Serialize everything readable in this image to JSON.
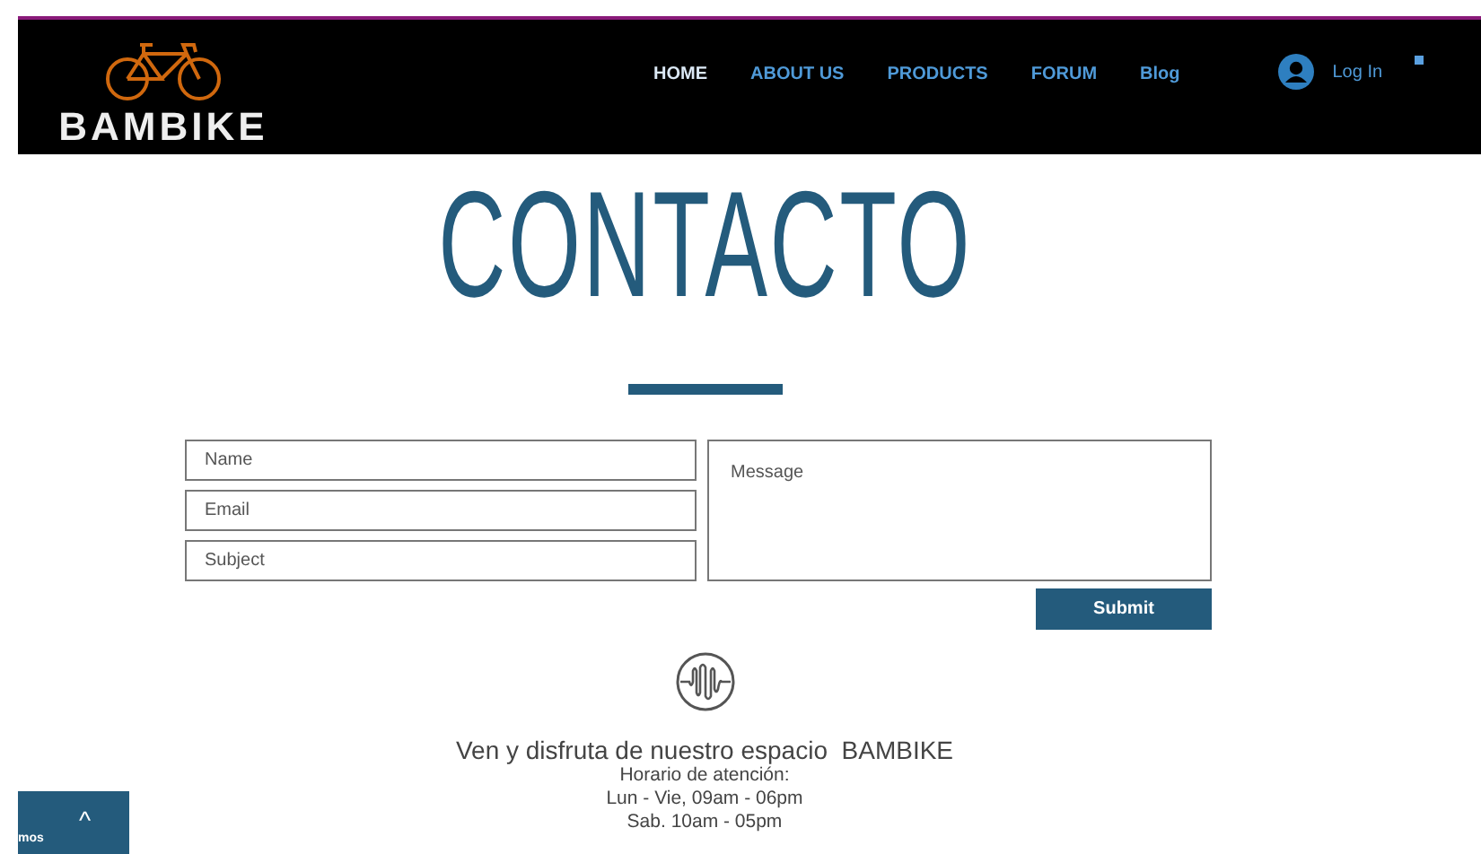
{
  "header": {
    "logo_text": "BAMBIKE",
    "nav": [
      {
        "label": "HOME",
        "selected": true
      },
      {
        "label": "ABOUT US",
        "selected": false
      },
      {
        "label": "PRODUCTS",
        "selected": false
      },
      {
        "label": "FORUM",
        "selected": false
      },
      {
        "label": "Blog",
        "selected": false
      }
    ],
    "login": "Log In"
  },
  "title": "CONTACTO",
  "form": {
    "fields": [
      {
        "placeholder": "Name"
      },
      {
        "placeholder": "Email"
      },
      {
        "placeholder": "Subject"
      }
    ],
    "message": {
      "placeholder": "Message"
    },
    "submit": "Submit"
  },
  "info": {
    "heading": "Ven y disfruta de nuestro espacio  BAMBIKE",
    "lines": [
      "Horario de atención:",
      "Lun - Vie, 09am - 06pm",
      "Sab. 10am - 05pm"
    ]
  },
  "chat_widget": {
    "label": "mos",
    "chevron": "^"
  }
}
